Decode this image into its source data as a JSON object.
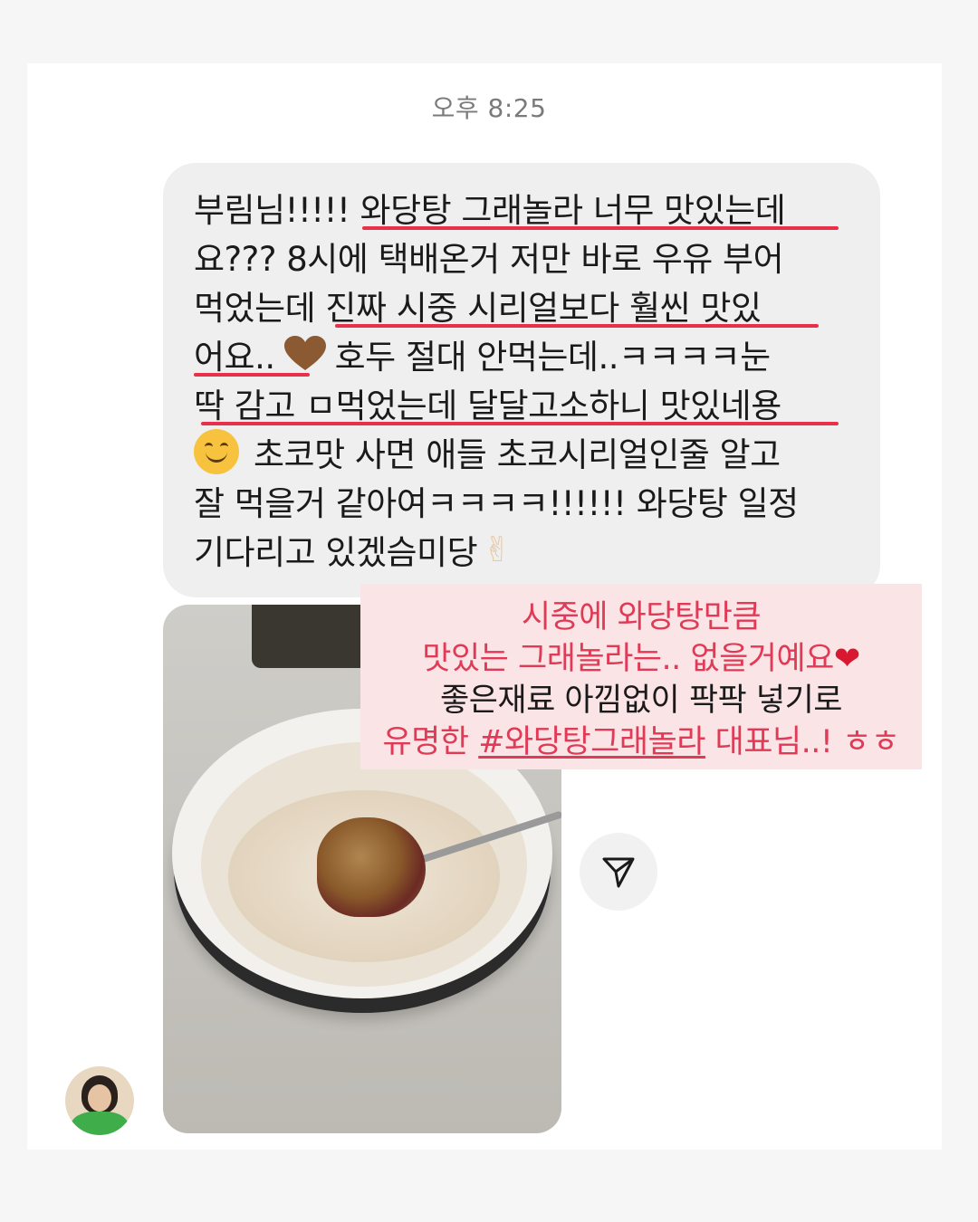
{
  "timestamp": "오후 8:25",
  "message": {
    "lines": [
      "부림님!!!!! 와당탕 그래놀라 너무 맛있는데",
      "요??? 8시에 택배온거 저만 바로 우유 부어",
      "먹었는데 진짜 시중 시리얼보다 훨씬 맛있",
      "어요..",
      "호두 절대 안먹는데..ㅋㅋㅋㅋ눈",
      "딱 감고 ㅁ먹었는데 달달고소하니 맛있네용",
      "초코맛 사면 애들 초코시리얼인줄 알고",
      "잘 먹을거 같아여ㅋㅋㅋㅋ!!!!!! 와당탕 일정",
      "기다리고 있겠슴미당"
    ],
    "victory_emoji": "✌"
  },
  "overlay": {
    "line1": "시중에 와당탕만큼",
    "line2": "맛있는 그래놀라는.. 없을거예요",
    "line2_heart": "❤",
    "line3": "좋은재료 아낌없이 팍팍 넣기로",
    "line4_prefix": "유명한 ",
    "line4_hashtag": "#와당탕그래놀라",
    "line4_suffix": " 대표님..! ㅎㅎ"
  },
  "colors": {
    "accent_pink": "#e03a56",
    "underline_red": "#e8304a",
    "bubble_bg": "#efefef",
    "overlay_bg": "#fbe4e6"
  },
  "icons": {
    "share": "paper-plane-icon",
    "heart_brown": "brown-heart-icon",
    "smile": "smiling-face-icon",
    "heart_red": "red-heart-icon"
  }
}
